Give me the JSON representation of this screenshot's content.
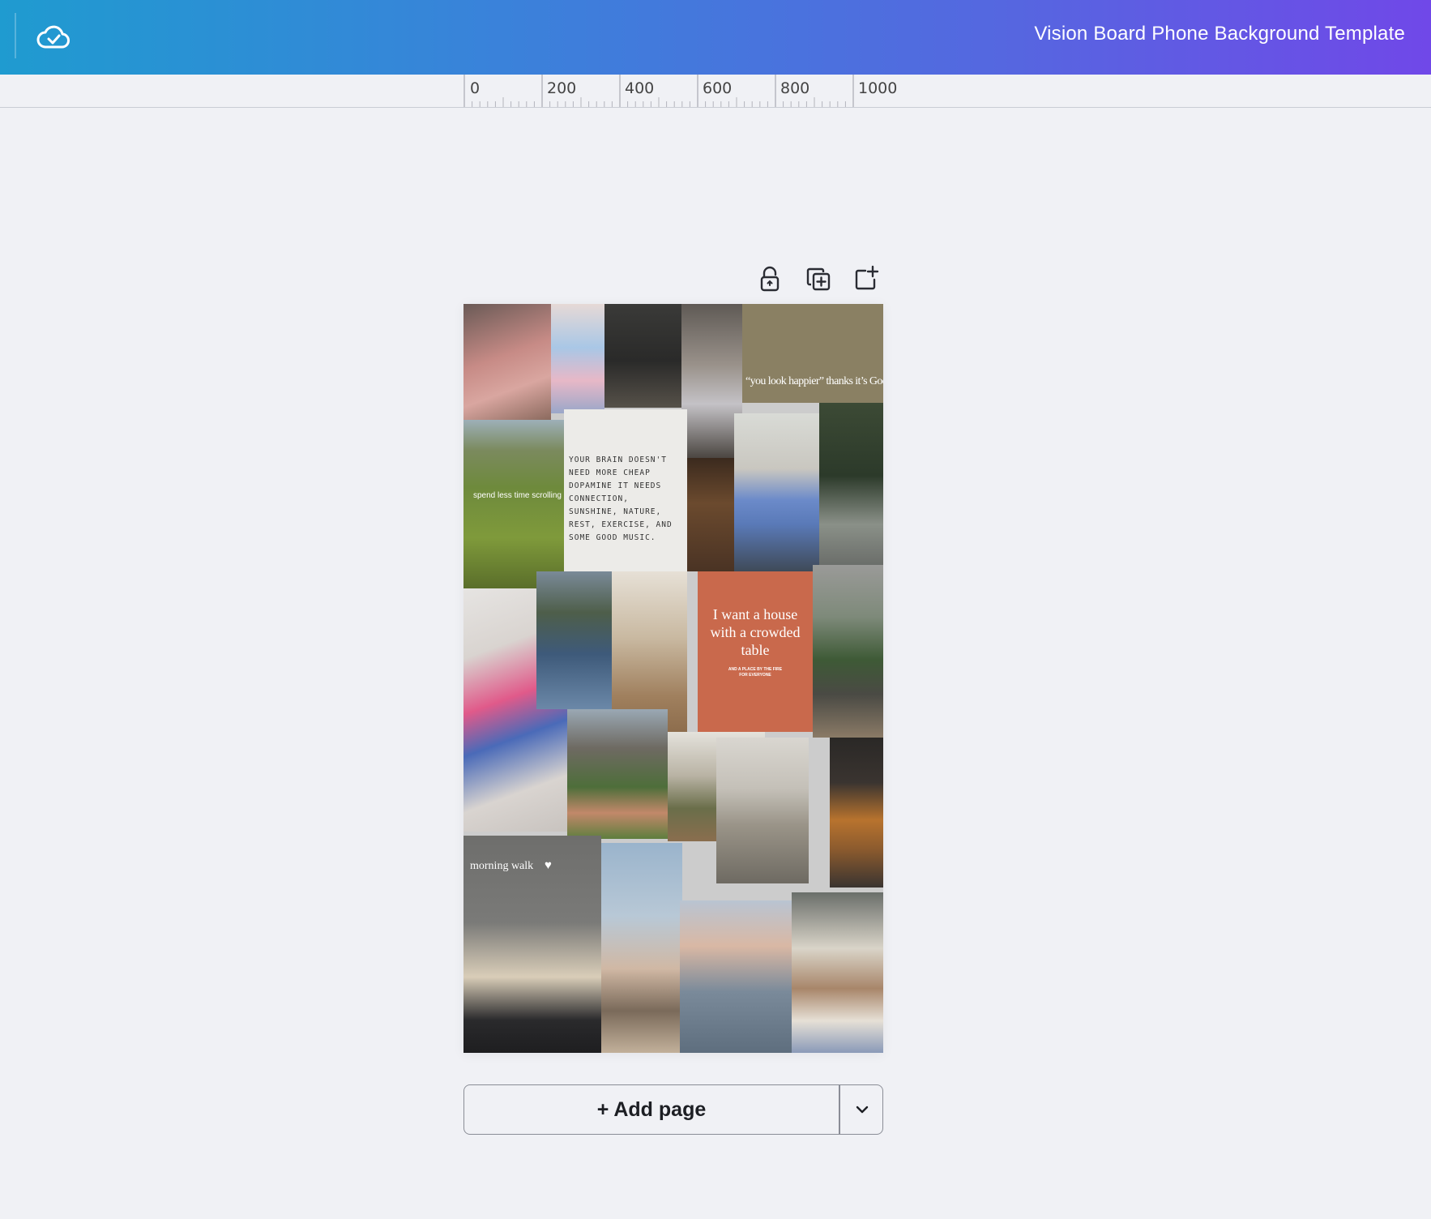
{
  "header": {
    "title": "Vision Board Phone Background Template",
    "save_status_icon": "cloud-check-icon"
  },
  "ruler": {
    "labels": [
      "0",
      "200",
      "400",
      "600",
      "800",
      "1000"
    ]
  },
  "page_actions": {
    "lock_icon": "unlock-icon",
    "duplicate_icon": "duplicate-page-icon",
    "add_icon": "add-page-icon"
  },
  "board": {
    "captions": {
      "god": "“you look happier” thanks it’s God",
      "scrolling": "spend less time scrolling",
      "note": "YOUR BRAIN DOESN'T NEED MORE CHEAP DOPAMINE IT NEEDS CONNECTION, SUNSHINE, NATURE, REST, EXERCISE, AND SOME GOOD MUSIC.",
      "house_main": "I want a house with a crowded table",
      "house_sub": "AND A PLACE BY THE FIRE FOR EVERYONE",
      "walk": "morning walk"
    }
  },
  "footer": {
    "add_page_label": "+ Add page",
    "more_icon": "chevron-down-icon"
  },
  "colors": {
    "header_start": "#1f9bd0",
    "header_end": "#7048e8",
    "canvas_bg": "#f0f1f5",
    "terracotta": "#c9694c"
  }
}
